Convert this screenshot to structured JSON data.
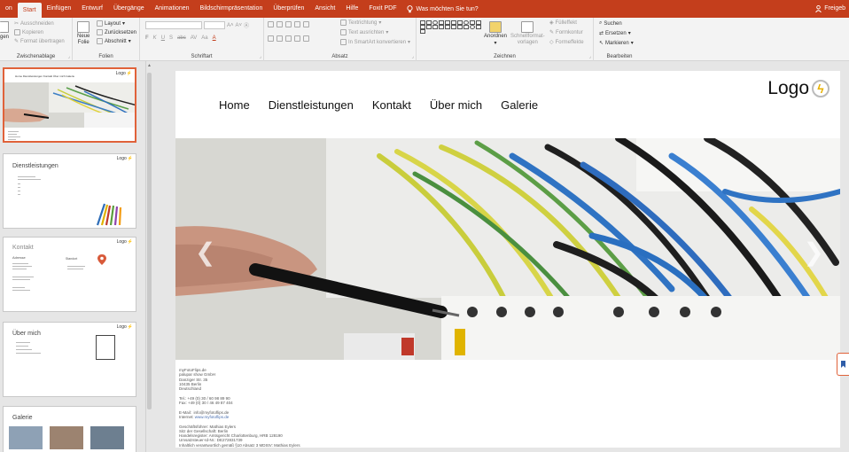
{
  "tabs": [
    "on",
    "Start",
    "Einfügen",
    "Entwurf",
    "Übergänge",
    "Animationen",
    "Bildschirmpräsentation",
    "Überprüfen",
    "Ansicht",
    "Hilfe",
    "Foxit PDF"
  ],
  "tell_me": "Was möchten Sie tun?",
  "share": "Freigeb",
  "ribbon": {
    "clipboard": {
      "paste": "gen",
      "cut": "Ausschneiden",
      "copy": "Kopieren",
      "format_painter": "Format übertragen",
      "label": "Zwischenablage"
    },
    "slides": {
      "new_slide": "Neue",
      "new_slide2": "Folie",
      "layout": "Layout",
      "reset": "Zurücksetzen",
      "section": "Abschnitt",
      "label": "Folien"
    },
    "font": {
      "bold": "F",
      "italic": "K",
      "underline": "U",
      "strike": "S",
      "shadow": "abc",
      "spacing": "AV",
      "case": "Aa",
      "label": "Schriftart"
    },
    "paragraph": {
      "text_direction": "Textrichtung",
      "align_text": "Text ausrichten",
      "smartart": "In SmartArt konvertieren",
      "label": "Absatz"
    },
    "drawing": {
      "arrange": "Anordnen",
      "quick_styles": "Schnellformat-",
      "quick_styles2": "vorlagen",
      "fill": "Fülleffekt",
      "outline": "Formkontur",
      "effects": "Formeffekte",
      "label": "Zeichnen"
    },
    "editing": {
      "find": "Suchen",
      "replace": "Ersetzen",
      "select": "Markieren",
      "label": "Bearbeiten"
    }
  },
  "thumbs": [
    {
      "logo": "Logo",
      "title": "",
      "nav": "Home  Dienstleistungen  Kontakt  Über mich  Galerie"
    },
    {
      "logo": "Logo",
      "title": "Dienstleistungen"
    },
    {
      "logo": "Logo",
      "title": "Kontakt",
      "sub1": "Adresse",
      "sub2": "Standort"
    },
    {
      "logo": "Logo",
      "title": "Über mich"
    },
    {
      "logo": "",
      "title": "Galerie"
    }
  ],
  "slide": {
    "nav": [
      "Home",
      "Dienstleistungen",
      "Kontakt",
      "Über mich",
      "Galerie"
    ],
    "logo": "Logo",
    "imprint": {
      "l1": "myFotoFlips.de",
      "l2": "palupar show GmbH",
      "l3": "Danziger Str. 35",
      "l4": "10435 Berlin",
      "l5": "Deutschland",
      "tel": "Tel.: +49 (0) 30 / 60 98 89 90",
      "fax": "Fax: +49 (0) 30 / 46 49 87 404",
      "email": "E-Mail:  info@myfotoflips.de",
      "internet_label": "Internet:",
      "internet": "www.myfotoflips.de",
      "g1": "Geschäftsführer: Mathias Eylers",
      "g2": "Sitz der Gesellschaft: Berlin",
      "g3": "Handelsregister: Amtsgericht Charlottenburg, HRB 128190",
      "g4": "Umsatzsteuer-Id-Nr.: DE272831739",
      "g5": "Inhaltlich verantwortlich gemäß §10 Absatz 3 MDStV: Mathias Eylers"
    }
  }
}
